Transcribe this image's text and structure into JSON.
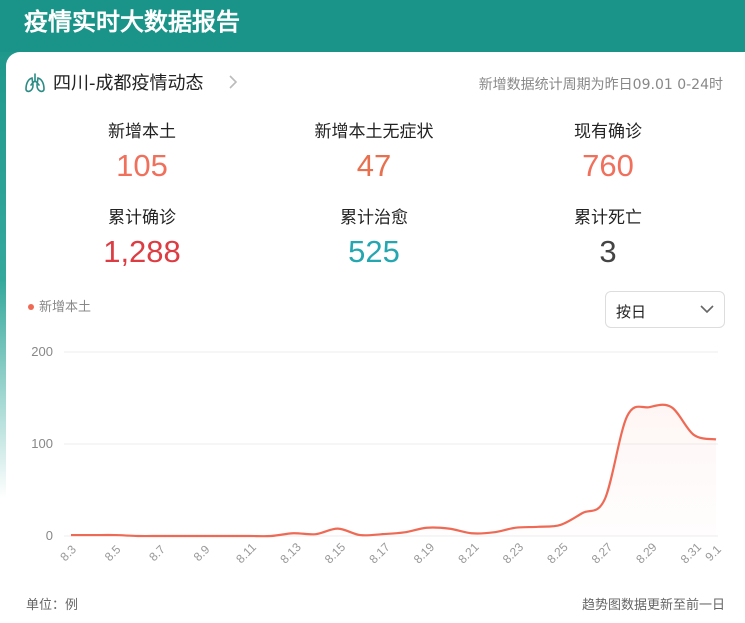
{
  "header": {
    "title": "疫情实时大数据报告"
  },
  "region": {
    "title": "四川-成都疫情动态",
    "period_note": "新增数据统计周期为昨日09.01 0-24时"
  },
  "stats": [
    {
      "label": "新增本土",
      "value": "105",
      "color": "#f0705c"
    },
    {
      "label": "新增本土无症状",
      "value": "47",
      "color": "#e8704e"
    },
    {
      "label": "现有确诊",
      "value": "760",
      "color": "#f0705c"
    },
    {
      "label": "累计确诊",
      "value": "1,288",
      "color": "#dc3c42"
    },
    {
      "label": "累计治愈",
      "value": "525",
      "color": "#24a7b0"
    },
    {
      "label": "累计死亡",
      "value": "3",
      "color": "#444444"
    }
  ],
  "legend": {
    "label": "新增本土",
    "color": "#ef6a55"
  },
  "period_select": {
    "value": "按日"
  },
  "footer": {
    "unit": "单位：例",
    "trend_note": "趋势图数据更新至前一日"
  },
  "chart_data": {
    "type": "line",
    "series": [
      {
        "name": "新增本土",
        "color": "#ef6a55",
        "x": [
          "8.3",
          "8.4",
          "8.5",
          "8.6",
          "8.7",
          "8.8",
          "8.9",
          "8.10",
          "8.11",
          "8.12",
          "8.13",
          "8.14",
          "8.15",
          "8.16",
          "8.17",
          "8.18",
          "8.19",
          "8.20",
          "8.21",
          "8.22",
          "8.23",
          "8.24",
          "8.25",
          "8.26",
          "8.27",
          "8.28",
          "8.29",
          "8.30",
          "8.31",
          "9.1"
        ],
        "values": [
          1,
          1,
          1,
          0,
          0,
          0,
          0,
          0,
          0,
          0,
          3,
          2,
          8,
          1,
          2,
          4,
          9,
          8,
          3,
          4,
          9,
          10,
          12,
          25,
          40,
          130,
          140,
          140,
          110,
          105
        ]
      }
    ],
    "xticks": [
      "8.3",
      "8.5",
      "8.7",
      "8.9",
      "8.11",
      "8.13",
      "8.15",
      "8.17",
      "8.19",
      "8.21",
      "8.23",
      "8.25",
      "8.27",
      "8.29",
      "8.31",
      "9.1"
    ],
    "yticks": [
      "0",
      "100",
      "200"
    ],
    "ylim": [
      0,
      200
    ],
    "grid": true,
    "legend": "top-left"
  }
}
